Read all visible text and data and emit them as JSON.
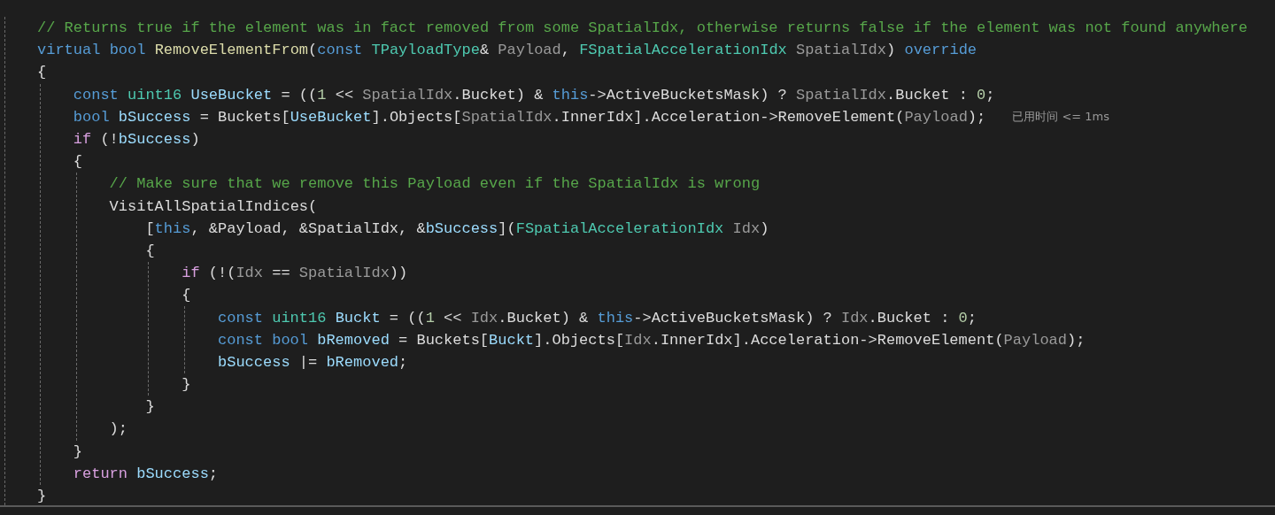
{
  "editor": {
    "lines": [
      {
        "tokens": [
          {
            "kind": "comment",
            "text": "// Returns true if the element was in fact removed from some SpatialIdx, otherwise returns false if the element was not found anywhere"
          }
        ]
      },
      {
        "tokens": [
          {
            "kind": "keyword",
            "text": "virtual "
          },
          {
            "kind": "keyword",
            "text": "bool "
          },
          {
            "kind": "function",
            "text": "RemoveElementFrom"
          },
          {
            "kind": "plain",
            "text": "("
          },
          {
            "kind": "keyword",
            "text": "const "
          },
          {
            "kind": "type",
            "text": "TPayloadType"
          },
          {
            "kind": "plain",
            "text": "& "
          },
          {
            "kind": "param",
            "text": "Payload"
          },
          {
            "kind": "plain",
            "text": ", "
          },
          {
            "kind": "type",
            "text": "FSpatialAccelerationIdx "
          },
          {
            "kind": "param",
            "text": "SpatialIdx"
          },
          {
            "kind": "plain",
            "text": ") "
          },
          {
            "kind": "keyword",
            "text": "override"
          }
        ]
      },
      {
        "tokens": [
          {
            "kind": "plain",
            "text": "{"
          }
        ],
        "block": {
          "guide": true,
          "lines": [
            {
              "tokens": [
                {
                  "kind": "keyword",
                  "text": "const "
                },
                {
                  "kind": "type",
                  "text": "uint16 "
                },
                {
                  "kind": "variable",
                  "text": "UseBucket"
                },
                {
                  "kind": "plain",
                  "text": " = (("
                },
                {
                  "kind": "number",
                  "text": "1"
                },
                {
                  "kind": "plain",
                  "text": " << "
                },
                {
                  "kind": "param",
                  "text": "SpatialIdx"
                },
                {
                  "kind": "plain",
                  "text": ".Bucket) & "
                },
                {
                  "kind": "keyword",
                  "text": "this"
                },
                {
                  "kind": "plain",
                  "text": "->ActiveBucketsMask) ? "
                },
                {
                  "kind": "param",
                  "text": "SpatialIdx"
                },
                {
                  "kind": "plain",
                  "text": ".Bucket : "
                },
                {
                  "kind": "number",
                  "text": "0"
                },
                {
                  "kind": "plain",
                  "text": ";"
                }
              ]
            },
            {
              "tokens": [
                {
                  "kind": "keyword",
                  "text": "bool "
                },
                {
                  "kind": "variable",
                  "text": "bSuccess"
                },
                {
                  "kind": "plain",
                  "text": " = Buckets["
                },
                {
                  "kind": "variable",
                  "text": "UseBucket"
                },
                {
                  "kind": "plain",
                  "text": "].Objects["
                },
                {
                  "kind": "param",
                  "text": "SpatialIdx"
                },
                {
                  "kind": "plain",
                  "text": ".InnerIdx].Acceleration->RemoveElement("
                },
                {
                  "kind": "param",
                  "text": "Payload"
                },
                {
                  "kind": "plain",
                  "text": ");"
                }
              ],
              "hint": "已用时间 <= 1ms"
            },
            {
              "tokens": [
                {
                  "kind": "control",
                  "text": "if"
                },
                {
                  "kind": "plain",
                  "text": " (!"
                },
                {
                  "kind": "variable",
                  "text": "bSuccess"
                },
                {
                  "kind": "plain",
                  "text": ")"
                }
              ]
            },
            {
              "tokens": [
                {
                  "kind": "plain",
                  "text": "{"
                }
              ],
              "block": {
                "guide": true,
                "lines": [
                  {
                    "tokens": [
                      {
                        "kind": "comment",
                        "text": "// Make sure that we remove this Payload even if the SpatialIdx is wrong"
                      }
                    ]
                  },
                  {
                    "tokens": [
                      {
                        "kind": "plain",
                        "text": "VisitAllSpatialIndices("
                      }
                    ],
                    "block": {
                      "guide": false,
                      "lines": [
                        {
                          "tokens": [
                            {
                              "kind": "plain",
                              "text": "["
                            },
                            {
                              "kind": "keyword",
                              "text": "this"
                            },
                            {
                              "kind": "plain",
                              "text": ", &Payload, &SpatialIdx, &"
                            },
                            {
                              "kind": "variable",
                              "text": "bSuccess"
                            },
                            {
                              "kind": "plain",
                              "text": "]("
                            },
                            {
                              "kind": "type",
                              "text": "FSpatialAccelerationIdx "
                            },
                            {
                              "kind": "param",
                              "text": "Idx"
                            },
                            {
                              "kind": "plain",
                              "text": ")"
                            }
                          ]
                        },
                        {
                          "tokens": [
                            {
                              "kind": "plain",
                              "text": "{"
                            }
                          ],
                          "block": {
                            "guide": true,
                            "lines": [
                              {
                                "tokens": [
                                  {
                                    "kind": "control",
                                    "text": "if"
                                  },
                                  {
                                    "kind": "plain",
                                    "text": " (!("
                                  },
                                  {
                                    "kind": "param",
                                    "text": "Idx"
                                  },
                                  {
                                    "kind": "plain",
                                    "text": " == "
                                  },
                                  {
                                    "kind": "param",
                                    "text": "SpatialIdx"
                                  },
                                  {
                                    "kind": "plain",
                                    "text": "))"
                                  }
                                ]
                              },
                              {
                                "tokens": [
                                  {
                                    "kind": "plain",
                                    "text": "{"
                                  }
                                ],
                                "block": {
                                  "guide": true,
                                  "lines": [
                                    {
                                      "tokens": [
                                        {
                                          "kind": "keyword",
                                          "text": "const "
                                        },
                                        {
                                          "kind": "type",
                                          "text": "uint16 "
                                        },
                                        {
                                          "kind": "variable",
                                          "text": "Buckt"
                                        },
                                        {
                                          "kind": "plain",
                                          "text": " = (("
                                        },
                                        {
                                          "kind": "number",
                                          "text": "1"
                                        },
                                        {
                                          "kind": "plain",
                                          "text": " << "
                                        },
                                        {
                                          "kind": "param",
                                          "text": "Idx"
                                        },
                                        {
                                          "kind": "plain",
                                          "text": ".Bucket) & "
                                        },
                                        {
                                          "kind": "keyword",
                                          "text": "this"
                                        },
                                        {
                                          "kind": "plain",
                                          "text": "->ActiveBucketsMask) ? "
                                        },
                                        {
                                          "kind": "param",
                                          "text": "Idx"
                                        },
                                        {
                                          "kind": "plain",
                                          "text": ".Bucket : "
                                        },
                                        {
                                          "kind": "number",
                                          "text": "0"
                                        },
                                        {
                                          "kind": "plain",
                                          "text": ";"
                                        }
                                      ]
                                    },
                                    {
                                      "tokens": [
                                        {
                                          "kind": "keyword",
                                          "text": "const "
                                        },
                                        {
                                          "kind": "keyword",
                                          "text": "bool "
                                        },
                                        {
                                          "kind": "variable",
                                          "text": "bRemoved"
                                        },
                                        {
                                          "kind": "plain",
                                          "text": " = Buckets["
                                        },
                                        {
                                          "kind": "variable",
                                          "text": "Buckt"
                                        },
                                        {
                                          "kind": "plain",
                                          "text": "].Objects["
                                        },
                                        {
                                          "kind": "param",
                                          "text": "Idx"
                                        },
                                        {
                                          "kind": "plain",
                                          "text": ".InnerIdx].Acceleration->RemoveElement("
                                        },
                                        {
                                          "kind": "param",
                                          "text": "Payload"
                                        },
                                        {
                                          "kind": "plain",
                                          "text": ");"
                                        }
                                      ]
                                    },
                                    {
                                      "tokens": [
                                        {
                                          "kind": "variable",
                                          "text": "bSuccess"
                                        },
                                        {
                                          "kind": "plain",
                                          "text": " |= "
                                        },
                                        {
                                          "kind": "variable",
                                          "text": "bRemoved"
                                        },
                                        {
                                          "kind": "plain",
                                          "text": ";"
                                        }
                                      ]
                                    }
                                  ]
                                }
                              },
                              {
                                "tokens": [
                                  {
                                    "kind": "plain",
                                    "text": "}"
                                  }
                                ]
                              }
                            ]
                          }
                        },
                        {
                          "tokens": [
                            {
                              "kind": "plain",
                              "text": "}"
                            }
                          ]
                        }
                      ]
                    }
                  },
                  {
                    "tokens": [
                      {
                        "kind": "plain",
                        "text": ");"
                      }
                    ]
                  }
                ]
              }
            },
            {
              "tokens": [
                {
                  "kind": "plain",
                  "text": "}"
                }
              ]
            },
            {
              "tokens": [
                {
                  "kind": "control",
                  "text": "return "
                },
                {
                  "kind": "variable",
                  "text": "bSuccess"
                },
                {
                  "kind": "plain",
                  "text": ";"
                }
              ]
            }
          ]
        }
      },
      {
        "tokens": [
          {
            "kind": "plain",
            "text": "}"
          }
        ]
      }
    ]
  }
}
